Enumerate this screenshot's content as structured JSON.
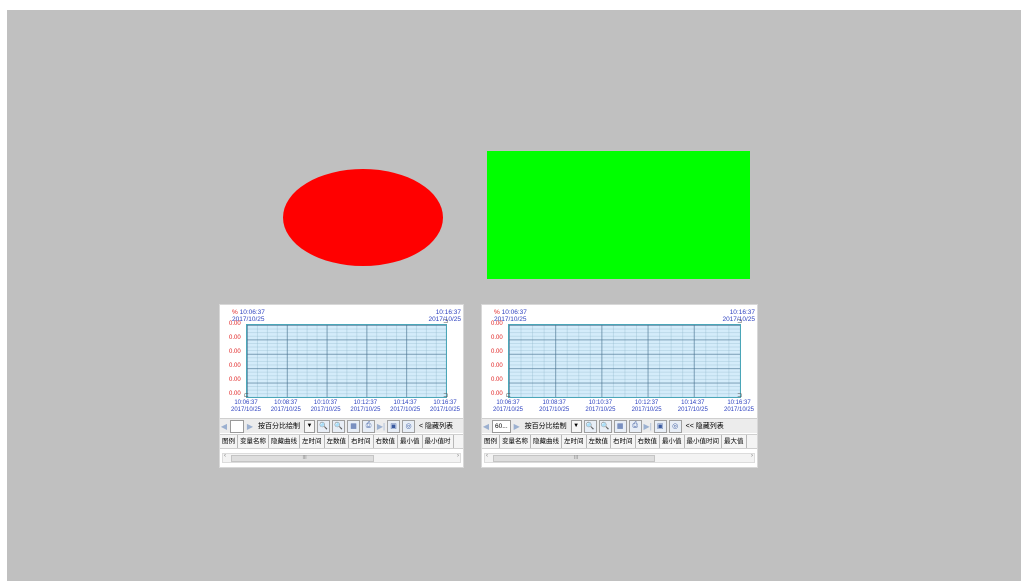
{
  "colors": {
    "ellipse": "#ff0000",
    "rectangle": "#00ff00",
    "background": "#c0c0c0"
  },
  "trend_left": {
    "unit": "%",
    "start_time": "10:06:37",
    "start_date": "2017/10/25",
    "end_time": "10:16:37",
    "end_date": "2017/10/25",
    "y_ticks": [
      "0.00",
      "0.00",
      "0.00",
      "0.00",
      "0.00",
      "0.00"
    ],
    "x_ticks": [
      {
        "time": "10:06:37",
        "date": "2017/10/25"
      },
      {
        "time": "10:08:37",
        "date": "2017/10/25"
      },
      {
        "time": "10:10:37",
        "date": "2017/10/25"
      },
      {
        "time": "10:12:37",
        "date": "2017/10/25"
      },
      {
        "time": "10:14:37",
        "date": "2017/10/25"
      },
      {
        "time": "10:16:37",
        "date": "2017/10/25"
      }
    ],
    "toolbar": {
      "prev_icon": "◀",
      "period": "",
      "next_icon": "▶",
      "mode": "按百分比绘制",
      "dropdown_icon": "▼",
      "zoom_in_icon": "🔍",
      "zoom_out_icon": "🔍",
      "grid_icon": "▦",
      "print_icon": "⎙",
      "end_icon": "▶|",
      "save_icon": "▣",
      "settings_icon": "◎",
      "collapse": "< 隐藏列表"
    },
    "columns": [
      "图例",
      "变量名称",
      "隐藏曲线",
      "左时间",
      "左数值",
      "右时间",
      "右数值",
      "最小值",
      "最小值时"
    ],
    "scroll_mark": "III"
  },
  "trend_right": {
    "unit": "%",
    "start_time": "10:06:37",
    "start_date": "2017/10/25",
    "end_time": "10:16:37",
    "end_date": "2017/10/25",
    "y_ticks": [
      "0.00",
      "0.00",
      "0.00",
      "0.00",
      "0.00",
      "0.00"
    ],
    "x_ticks": [
      {
        "time": "10:06:37",
        "date": "2017/10/25"
      },
      {
        "time": "10:08:37",
        "date": "2017/10/25"
      },
      {
        "time": "10:10:37",
        "date": "2017/10/25"
      },
      {
        "time": "10:12:37",
        "date": "2017/10/25"
      },
      {
        "time": "10:14:37",
        "date": "2017/10/25"
      },
      {
        "time": "10:16:37",
        "date": "2017/10/25"
      }
    ],
    "toolbar": {
      "prev_icon": "◀",
      "period": "60...",
      "next_icon": "▶",
      "mode": "按百分比绘制",
      "dropdown_icon": "▼",
      "zoom_in_icon": "🔍",
      "zoom_out_icon": "🔍",
      "grid_icon": "▦",
      "print_icon": "⎙",
      "end_icon": "▶|",
      "save_icon": "▣",
      "settings_icon": "◎",
      "collapse": "<< 隐藏列表"
    },
    "columns": [
      "图例",
      "变量名称",
      "隐藏曲线",
      "左时间",
      "左数值",
      "右时间",
      "右数值",
      "最小值",
      "最小值时间",
      "最大值"
    ],
    "scroll_mark": "III"
  }
}
